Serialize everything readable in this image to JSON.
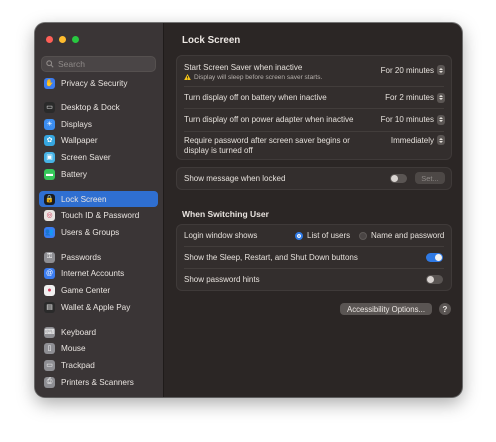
{
  "window": {
    "traffic_lights": [
      "#ff5f57",
      "#febc2e",
      "#28c840"
    ]
  },
  "sidebar": {
    "search_placeholder": "Search",
    "items": [
      {
        "label": "Privacy & Security",
        "icon": "hand-icon",
        "color": "#3b7cf0",
        "glyph": "✋"
      },
      {
        "label": "Desktop & Dock",
        "icon": "desktop-icon",
        "color": "#2a2a2a",
        "glyph": "▭"
      },
      {
        "label": "Displays",
        "icon": "sun-icon",
        "color": "#3b8df0",
        "glyph": "☀"
      },
      {
        "label": "Wallpaper",
        "icon": "flower-icon",
        "color": "#36a6e0",
        "glyph": "✿"
      },
      {
        "label": "Screen Saver",
        "icon": "screensaver-icon",
        "color": "#47b3e6",
        "glyph": "▣"
      },
      {
        "label": "Battery",
        "icon": "battery-icon",
        "color": "#34c759",
        "glyph": "▬"
      },
      {
        "label": "Lock Screen",
        "icon": "lock-icon",
        "color": "#1c1c1e",
        "glyph": "🔒"
      },
      {
        "label": "Touch ID & Password",
        "icon": "fingerprint-icon",
        "color": "#e8e3e0",
        "glyph": "◎"
      },
      {
        "label": "Users & Groups",
        "icon": "users-icon",
        "color": "#3b7cf0",
        "glyph": "👥"
      },
      {
        "label": "Passwords",
        "icon": "key-icon",
        "color": "#8e8e93",
        "glyph": "⚿"
      },
      {
        "label": "Internet Accounts",
        "icon": "at-icon",
        "color": "#3b7cf0",
        "glyph": "@"
      },
      {
        "label": "Game Center",
        "icon": "game-center-icon",
        "color": "#f0f0f0",
        "glyph": "●"
      },
      {
        "label": "Wallet & Apple Pay",
        "icon": "wallet-icon",
        "color": "#2a2a2a",
        "glyph": "▤"
      },
      {
        "label": "Keyboard",
        "icon": "keyboard-icon",
        "color": "#8e8e93",
        "glyph": "⌨"
      },
      {
        "label": "Mouse",
        "icon": "mouse-icon",
        "color": "#8e8e93",
        "glyph": "▯"
      },
      {
        "label": "Trackpad",
        "icon": "trackpad-icon",
        "color": "#8e8e93",
        "glyph": "▭"
      },
      {
        "label": "Printers & Scanners",
        "icon": "printer-icon",
        "color": "#8e8e93",
        "glyph": "⎙"
      }
    ],
    "active_label": "Lock Screen"
  },
  "main": {
    "title": "Lock Screen",
    "screen_saver": {
      "label": "Start Screen Saver when inactive",
      "sub_warning": "Display will sleep before screen saver starts.",
      "value": "For 20 minutes"
    },
    "display_off_battery": {
      "label": "Turn display off on battery when inactive",
      "value": "For 2 minutes"
    },
    "display_off_adapter": {
      "label": "Turn display off on power adapter when inactive",
      "value": "For 10 minutes"
    },
    "require_password": {
      "label_line1": "Require password after screen saver begins or",
      "label_line2": "display is turned off",
      "value": "Immediately"
    },
    "show_message": {
      "label": "Show message when locked",
      "enabled": false,
      "set_label": "Set..."
    },
    "switching_header": "When Switching User",
    "login_window": {
      "label": "Login window shows",
      "options": [
        "List of users",
        "Name and password"
      ],
      "selected": "List of users"
    },
    "sleep_restart": {
      "label": "Show the Sleep, Restart, and Shut Down buttons",
      "enabled": true
    },
    "password_hints": {
      "label": "Show password hints",
      "enabled": false
    },
    "accessibility_button": "Accessibility Options...",
    "help_button": "?"
  },
  "colors": {
    "accent": "#2f6fd1",
    "toggle_on": "#2f7ae5",
    "toggle_off": "#5a5553",
    "warning": "#f5c518"
  }
}
